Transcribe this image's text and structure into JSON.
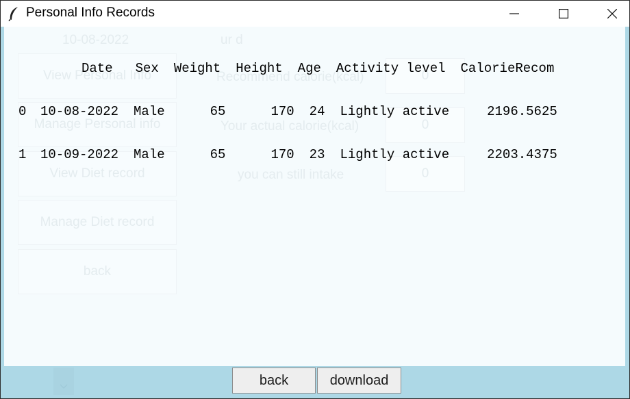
{
  "window": {
    "title": "Personal Info Records",
    "controls": {
      "minimize": "—",
      "maximize": "☐",
      "close": "✕"
    }
  },
  "background_app": {
    "date_stub": "10-08-2022",
    "header_stub": "ur d",
    "nav_buttons": [
      "View Personal Info",
      "Manage Personal info",
      "View Diet record",
      "Manage Diet record",
      "back"
    ],
    "fields": [
      {
        "label": "Recommend calorie(kcal)",
        "value": "0"
      },
      {
        "label": "Your actual calorie(kcal)",
        "value": "0"
      },
      {
        "label": "you can still intake",
        "value": "0"
      }
    ]
  },
  "records": {
    "columns": [
      "",
      "Date",
      "Sex",
      "Weight",
      "Height",
      "Age",
      "Activity level",
      "CalorieRecom"
    ],
    "rows": [
      [
        "0",
        "10-08-2022",
        "Male",
        "65",
        "170",
        "24",
        "Lightly active",
        "2196.5625"
      ],
      [
        "1",
        "10-09-2022",
        "Male",
        "65",
        "170",
        "23",
        "Lightly active",
        "2203.4375"
      ]
    ]
  },
  "buttons": {
    "back": "back",
    "download": "download"
  }
}
